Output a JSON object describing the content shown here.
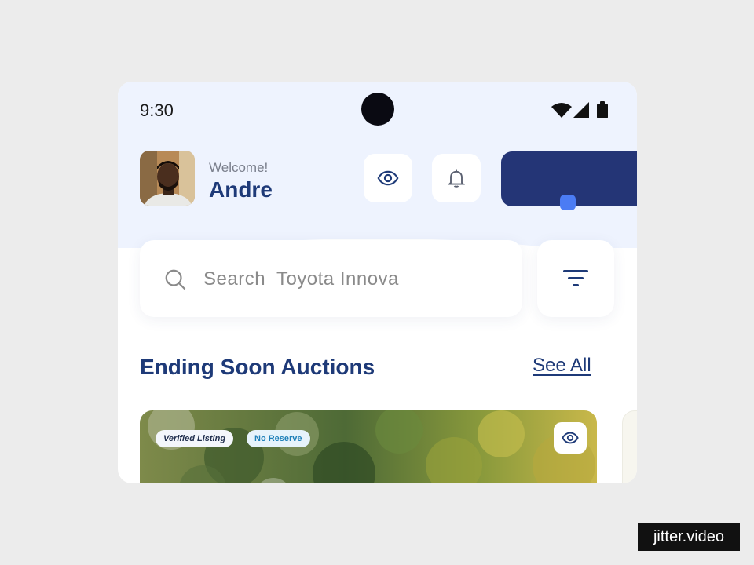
{
  "status_bar": {
    "time": "9:30"
  },
  "header": {
    "welcome": "Welcome!",
    "username": "Andre"
  },
  "search": {
    "placeholder": "Search  Toyota Innova"
  },
  "section": {
    "title": "Ending Soon Auctions",
    "see_all": "See All"
  },
  "auction_card": {
    "tags": [
      "Verified Listing",
      "No Reserve"
    ]
  },
  "brand": {
    "label": "jitter.video"
  },
  "colors": {
    "background": "#ececec",
    "header_bg": "#eef3fe",
    "primary": "#1e3a78",
    "wallet_card": "#243576",
    "accent_dot": "#4b7cf4"
  },
  "icons": [
    "wifi-icon",
    "signal-icon",
    "battery-icon",
    "eye-icon",
    "bell-icon",
    "search-icon",
    "filter-icon"
  ]
}
